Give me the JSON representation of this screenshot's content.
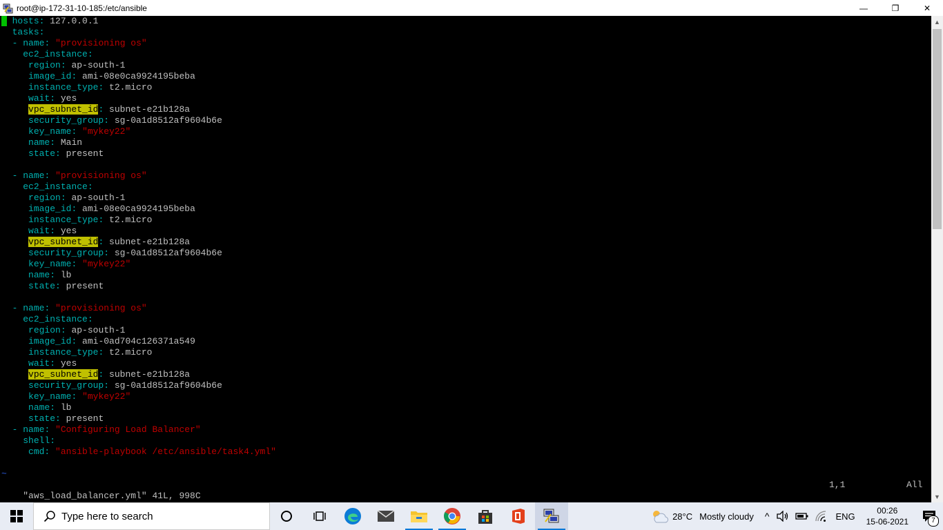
{
  "window": {
    "title": "root@ip-172-31-10-185:/etc/ansible",
    "minimize": "—",
    "restore": "❐",
    "close": "✕"
  },
  "editor": {
    "lines": [
      [
        [
          "cursor",
          "-"
        ],
        [
          "v",
          " "
        ],
        [
          "k",
          "hosts"
        ],
        [
          "k",
          ":"
        ],
        [
          "v",
          " 127.0.0.1"
        ]
      ],
      [
        [
          "v",
          "  "
        ],
        [
          "k",
          "tasks"
        ],
        [
          "k",
          ":"
        ]
      ],
      [
        [
          "v",
          "  "
        ],
        [
          "k",
          "-"
        ],
        [
          "v",
          " "
        ],
        [
          "k",
          "name"
        ],
        [
          "k",
          ":"
        ],
        [
          "v",
          " "
        ],
        [
          "s",
          "\"provisioning os\""
        ]
      ],
      [
        [
          "v",
          "    "
        ],
        [
          "k",
          "ec2_instance"
        ],
        [
          "k",
          ":"
        ]
      ],
      [
        [
          "v",
          "     "
        ],
        [
          "k",
          "region"
        ],
        [
          "k",
          ":"
        ],
        [
          "v",
          " ap-south-1"
        ]
      ],
      [
        [
          "v",
          "     "
        ],
        [
          "k",
          "image_id"
        ],
        [
          "k",
          ":"
        ],
        [
          "v",
          " ami-08e0ca9924195beba"
        ]
      ],
      [
        [
          "v",
          "     "
        ],
        [
          "k",
          "instance_type"
        ],
        [
          "k",
          ":"
        ],
        [
          "v",
          " t2.micro"
        ]
      ],
      [
        [
          "v",
          "     "
        ],
        [
          "k",
          "wait"
        ],
        [
          "k",
          ":"
        ],
        [
          "v",
          " yes"
        ]
      ],
      [
        [
          "v",
          "     "
        ],
        [
          "hl",
          "vpc_subnet_id"
        ],
        [
          "k",
          ":"
        ],
        [
          "v",
          " subnet-e21b128a"
        ]
      ],
      [
        [
          "v",
          "     "
        ],
        [
          "k",
          "security_group"
        ],
        [
          "k",
          ":"
        ],
        [
          "v",
          " sg-0a1d8512af9604b6e"
        ]
      ],
      [
        [
          "v",
          "     "
        ],
        [
          "k",
          "key_name"
        ],
        [
          "k",
          ":"
        ],
        [
          "v",
          " "
        ],
        [
          "s",
          "\"mykey22\""
        ]
      ],
      [
        [
          "v",
          "     "
        ],
        [
          "k",
          "name"
        ],
        [
          "k",
          ":"
        ],
        [
          "v",
          " Main"
        ]
      ],
      [
        [
          "v",
          "     "
        ],
        [
          "k",
          "state"
        ],
        [
          "k",
          ":"
        ],
        [
          "v",
          " present"
        ]
      ],
      [],
      [
        [
          "v",
          "  "
        ],
        [
          "k",
          "-"
        ],
        [
          "v",
          " "
        ],
        [
          "k",
          "name"
        ],
        [
          "k",
          ":"
        ],
        [
          "v",
          " "
        ],
        [
          "s",
          "\"provisioning os\""
        ]
      ],
      [
        [
          "v",
          "    "
        ],
        [
          "k",
          "ec2_instance"
        ],
        [
          "k",
          ":"
        ]
      ],
      [
        [
          "v",
          "     "
        ],
        [
          "k",
          "region"
        ],
        [
          "k",
          ":"
        ],
        [
          "v",
          " ap-south-1"
        ]
      ],
      [
        [
          "v",
          "     "
        ],
        [
          "k",
          "image_id"
        ],
        [
          "k",
          ":"
        ],
        [
          "v",
          " ami-08e0ca9924195beba"
        ]
      ],
      [
        [
          "v",
          "     "
        ],
        [
          "k",
          "instance_type"
        ],
        [
          "k",
          ":"
        ],
        [
          "v",
          " t2.micro"
        ]
      ],
      [
        [
          "v",
          "     "
        ],
        [
          "k",
          "wait"
        ],
        [
          "k",
          ":"
        ],
        [
          "v",
          " yes"
        ]
      ],
      [
        [
          "v",
          "     "
        ],
        [
          "hl",
          "vpc_subnet_id"
        ],
        [
          "k",
          ":"
        ],
        [
          "v",
          " subnet-e21b128a"
        ]
      ],
      [
        [
          "v",
          "     "
        ],
        [
          "k",
          "security_group"
        ],
        [
          "k",
          ":"
        ],
        [
          "v",
          " sg-0a1d8512af9604b6e"
        ]
      ],
      [
        [
          "v",
          "     "
        ],
        [
          "k",
          "key_name"
        ],
        [
          "k",
          ":"
        ],
        [
          "v",
          " "
        ],
        [
          "s",
          "\"mykey22\""
        ]
      ],
      [
        [
          "v",
          "     "
        ],
        [
          "k",
          "name"
        ],
        [
          "k",
          ":"
        ],
        [
          "v",
          " lb"
        ]
      ],
      [
        [
          "v",
          "     "
        ],
        [
          "k",
          "state"
        ],
        [
          "k",
          ":"
        ],
        [
          "v",
          " present"
        ]
      ],
      [],
      [
        [
          "v",
          "  "
        ],
        [
          "k",
          "-"
        ],
        [
          "v",
          " "
        ],
        [
          "k",
          "name"
        ],
        [
          "k",
          ":"
        ],
        [
          "v",
          " "
        ],
        [
          "s",
          "\"provisioning os\""
        ]
      ],
      [
        [
          "v",
          "    "
        ],
        [
          "k",
          "ec2_instance"
        ],
        [
          "k",
          ":"
        ]
      ],
      [
        [
          "v",
          "     "
        ],
        [
          "k",
          "region"
        ],
        [
          "k",
          ":"
        ],
        [
          "v",
          " ap-south-1"
        ]
      ],
      [
        [
          "v",
          "     "
        ],
        [
          "k",
          "image_id"
        ],
        [
          "k",
          ":"
        ],
        [
          "v",
          " ami-0ad704c126371a549"
        ]
      ],
      [
        [
          "v",
          "     "
        ],
        [
          "k",
          "instance_type"
        ],
        [
          "k",
          ":"
        ],
        [
          "v",
          " t2.micro"
        ]
      ],
      [
        [
          "v",
          "     "
        ],
        [
          "k",
          "wait"
        ],
        [
          "k",
          ":"
        ],
        [
          "v",
          " yes"
        ]
      ],
      [
        [
          "v",
          "     "
        ],
        [
          "hl",
          "vpc_subnet_id"
        ],
        [
          "k",
          ":"
        ],
        [
          "v",
          " subnet-e21b128a"
        ]
      ],
      [
        [
          "v",
          "     "
        ],
        [
          "k",
          "security_group"
        ],
        [
          "k",
          ":"
        ],
        [
          "v",
          " sg-0a1d8512af9604b6e"
        ]
      ],
      [
        [
          "v",
          "     "
        ],
        [
          "k",
          "key_name"
        ],
        [
          "k",
          ":"
        ],
        [
          "v",
          " "
        ],
        [
          "s",
          "\"mykey22\""
        ]
      ],
      [
        [
          "v",
          "     "
        ],
        [
          "k",
          "name"
        ],
        [
          "k",
          ":"
        ],
        [
          "v",
          " lb"
        ]
      ],
      [
        [
          "v",
          "     "
        ],
        [
          "k",
          "state"
        ],
        [
          "k",
          ":"
        ],
        [
          "v",
          " present"
        ]
      ],
      [
        [
          "v",
          "  "
        ],
        [
          "k",
          "-"
        ],
        [
          "v",
          " "
        ],
        [
          "k",
          "name"
        ],
        [
          "k",
          ":"
        ],
        [
          "v",
          " "
        ],
        [
          "s",
          "\"Configuring Load Balancer\""
        ]
      ],
      [
        [
          "v",
          "    "
        ],
        [
          "k",
          "shell"
        ],
        [
          "k",
          ":"
        ]
      ],
      [
        [
          "v",
          "     "
        ],
        [
          "k",
          "cmd"
        ],
        [
          "k",
          ":"
        ],
        [
          "v",
          " "
        ],
        [
          "s",
          "\"ansible-playbook /etc/ansible/task4.yml\""
        ]
      ],
      [],
      [
        [
          "tilde",
          "~"
        ]
      ]
    ],
    "status_file": "\"aws_load_balancer.yml\" 41L, 998C",
    "status_pos": "1,1",
    "status_scroll": "All"
  },
  "scrollbar": {
    "up": "▲",
    "down": "▼"
  },
  "taskbar": {
    "search_placeholder": "Type here to search",
    "weather_temp": "28°C",
    "weather_desc": "Mostly cloudy",
    "language": "ENG",
    "time": "00:26",
    "date": "15-06-2021",
    "notification_count": "7",
    "tray_chevron": "^"
  }
}
